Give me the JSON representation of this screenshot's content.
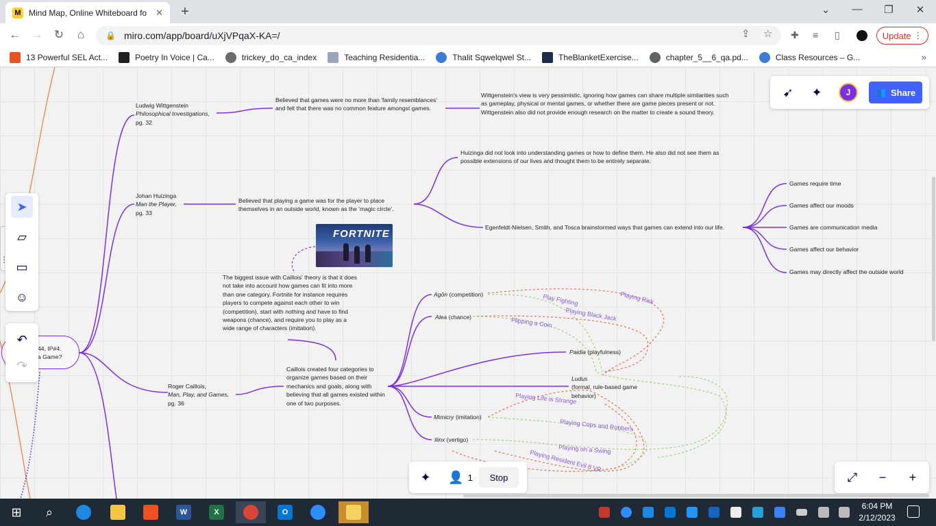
{
  "browser": {
    "tab_title": "Mind Map, Online Whiteboard fo",
    "favicon_letter": "M",
    "url": "miro.com/app/board/uXjVPqaX-KA=/",
    "update_label": "Update",
    "bookmarks": [
      {
        "label": "13 Powerful SEL Act...",
        "color": "#e8541f"
      },
      {
        "label": "Poetry In Voice | Ca...",
        "color": "#222222"
      },
      {
        "label": "trickey_do_ca_index",
        "color": "#6b6b6b"
      },
      {
        "label": "Teaching Residentia...",
        "color": "#9aa7b8"
      },
      {
        "label": "Thalit Sqwelqwel St...",
        "color": "#3a7bd5"
      },
      {
        "label": "TheBlanketExercise...",
        "color": "#1a2b4c"
      },
      {
        "label": "chapter_5__6_qa.pd...",
        "color": "#5f6368"
      },
      {
        "label": "Class Resources – G...",
        "color": "#3a7bd5"
      }
    ]
  },
  "board": {
    "root_text": "44, IP#4:\na Game?",
    "wittgenstein": {
      "name": "Ludwig Wittgenstein",
      "work": "Philosophical Investigations,",
      "page": "pg. 32",
      "belief": "Believed that games were no more than 'family resemblances' and felt that there was no common feature amongst games.",
      "critique": "Wittgenstein's view is very pessimistic, ignoring how games can share multiple similarities such as gameplay, physical or mental games, or whether there are game pieces present or not. Wittgenstein also did not provide enough research on the matter to create a sound theory."
    },
    "huizinga": {
      "name": "Johan Huizinga",
      "work": "Man the Player,",
      "page": "pg. 33",
      "belief": "Believed that playing a game was for the player to place themselves in an outside world, known as the 'magic circle'.",
      "critique": "Huizinga did not look into understanding games or how to define them. He also did not see them as possible extensions of our lives and thought them to be entirely separate.",
      "extension": "Egenfeldt-Nielsen, Smith, and Tosca brainstormed ways that games can extend into our life.",
      "ways": [
        "Games require time",
        "Games affect our moods",
        "Games are communication media",
        "Games affect our behavior",
        "Games may directly affect the outside world"
      ]
    },
    "fortnite_label": "FORTNITE",
    "caillois_critique": "The biggest issue with Caillois' theory is that it does not take into account how games can fit into more than one category. Fortnite for instance requires players to compete against each other to win (competition), start with nothing and have to find weapons (chance), and require you to play as a wide range of characters (imitation).",
    "caillois": {
      "name": "Roger Caillois,",
      "work": "Man, Play, and Games,",
      "page": "pg. 36",
      "belief": "Caillois created four categories to organize games based on their mechanics and goals, along with believing that all games existed within one of two purposes.",
      "categories": [
        {
          "term": "Agôn",
          "gloss": " (competition)"
        },
        {
          "term": "Alea",
          "gloss": " (chance)"
        },
        {
          "term": "Mimicry",
          "gloss": " (imitation)"
        },
        {
          "term": "Ilinx",
          "gloss": " (vertigo)"
        }
      ],
      "purposes": [
        {
          "term": "Paidia",
          "gloss": " (playfulness)"
        },
        {
          "term": "Ludus",
          "gloss": "(formal, rule-based game behavior)"
        }
      ],
      "examples": [
        "Playing Risk",
        "Play Fighting",
        "Playing Black Jack",
        "Flipping a Coin",
        "Playing Life is Strange",
        "Playing Cops and Robbers",
        "Playing on a Swing",
        "Playing Resident Evil 8 VR"
      ]
    }
  },
  "miro": {
    "avatar_initial": "J",
    "share_label": "Share",
    "participants": "1",
    "stop_label": "Stop"
  },
  "taskbar": {
    "time": "6:04 PM",
    "date": "2/12/2023"
  }
}
